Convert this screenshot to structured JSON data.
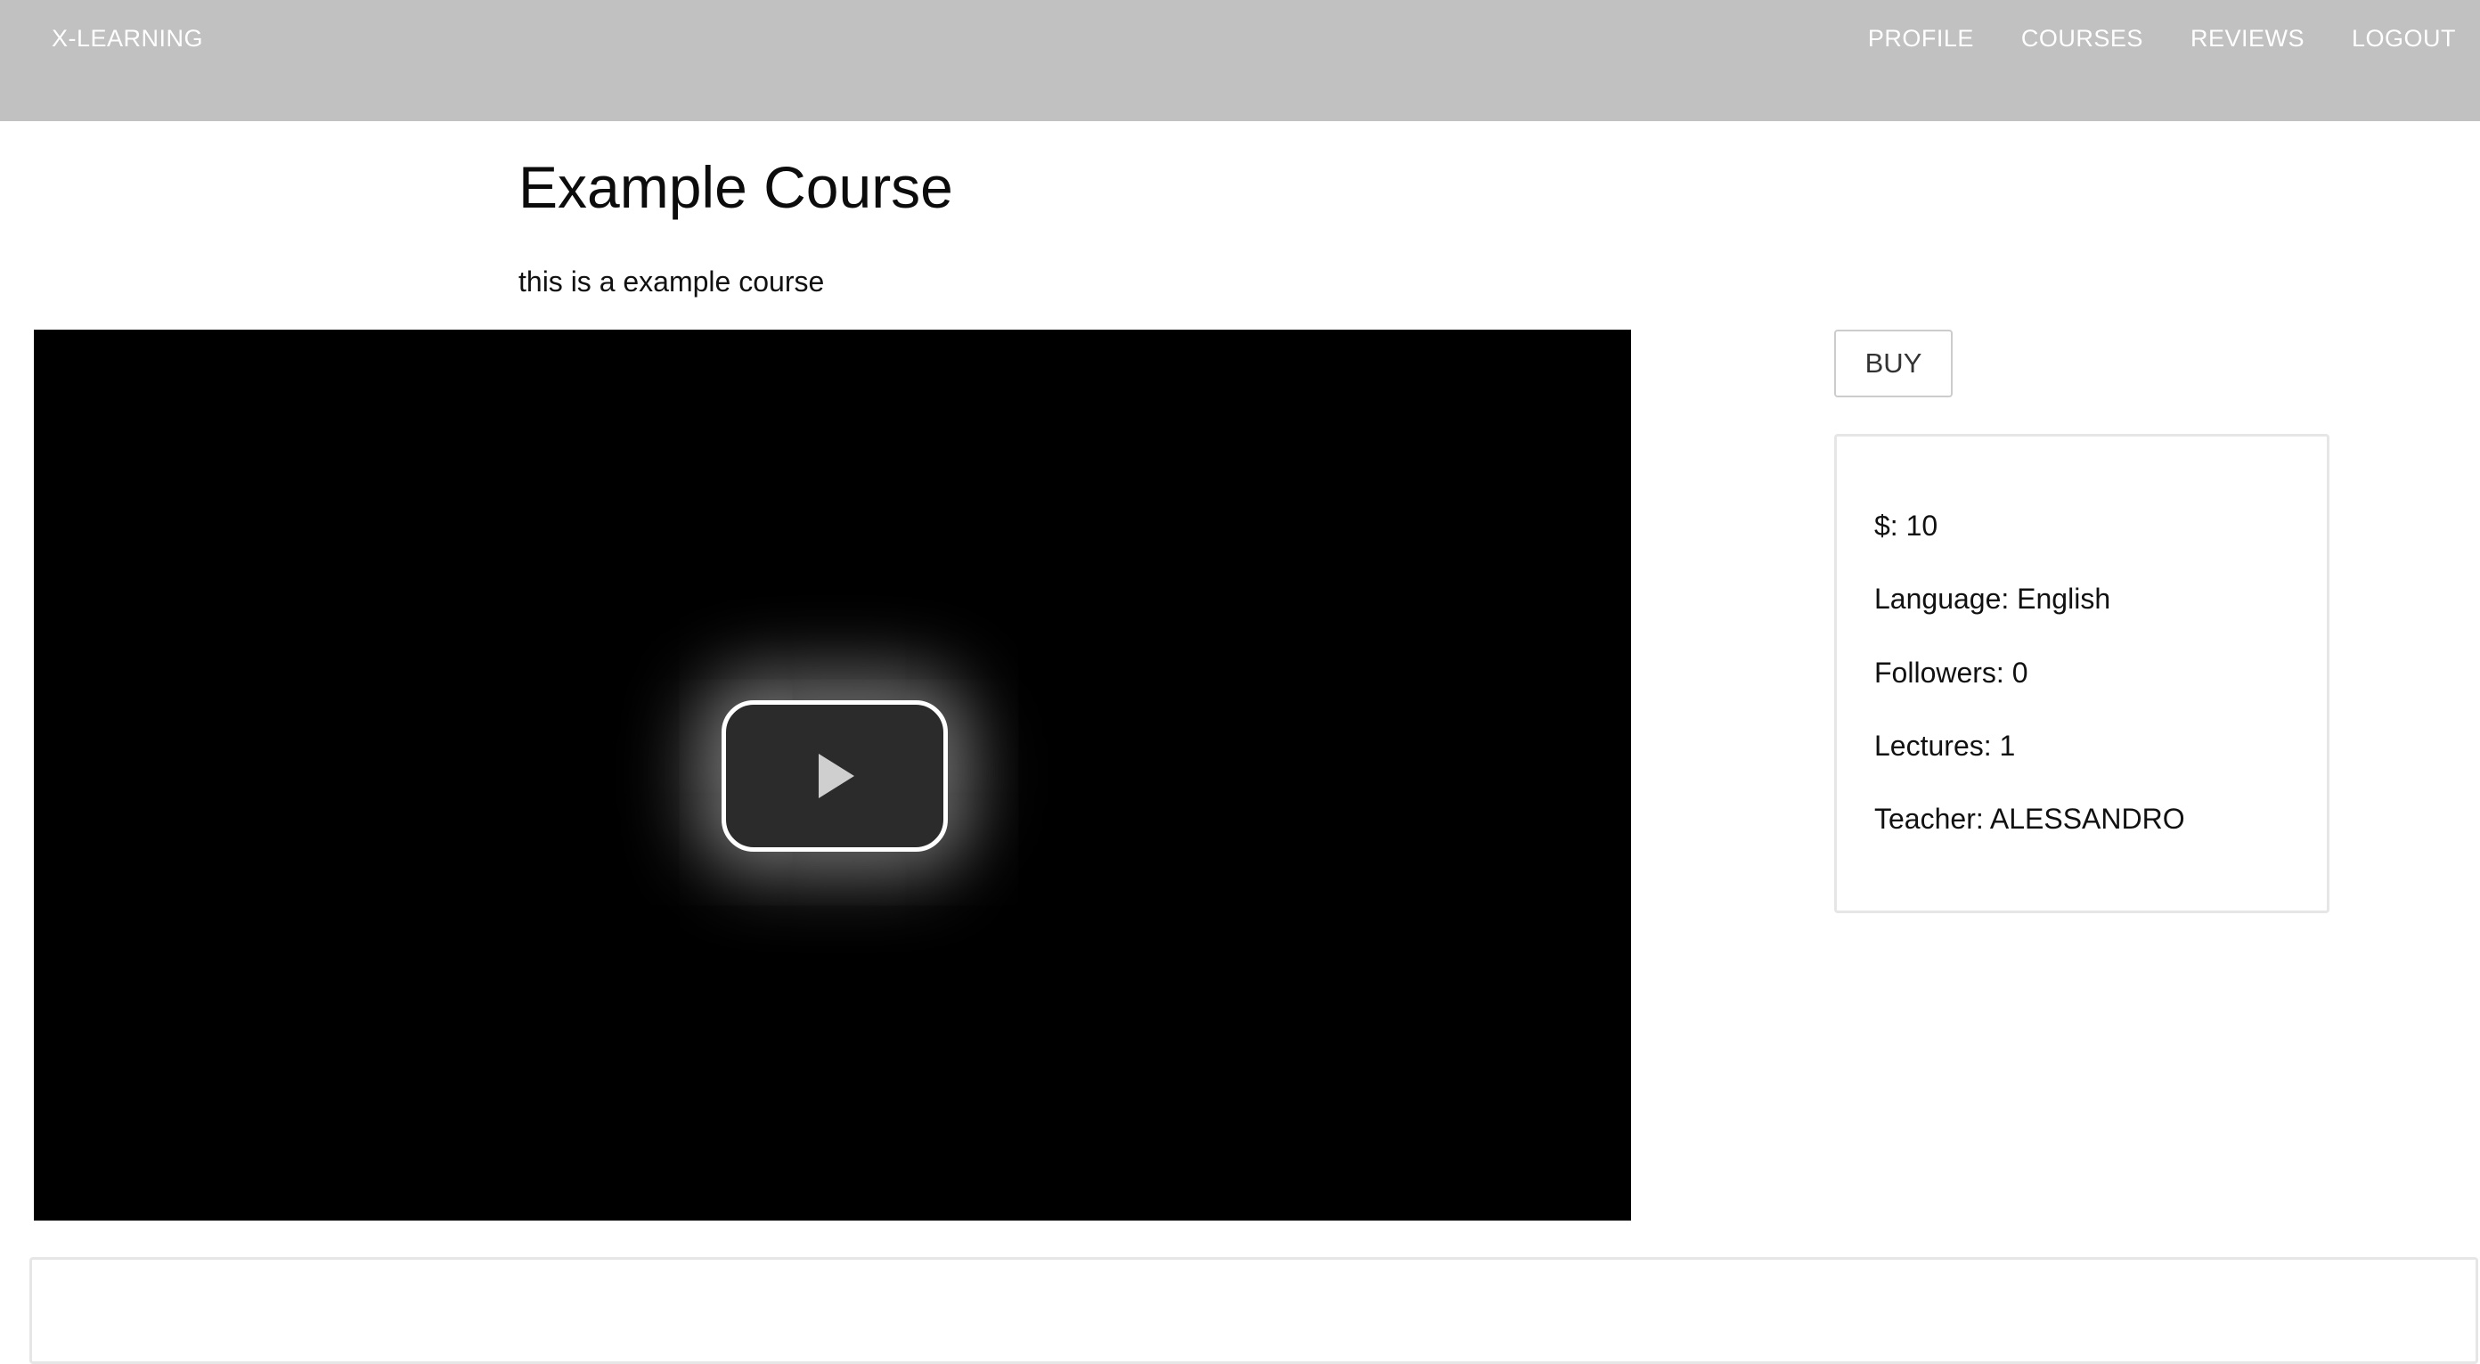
{
  "navbar": {
    "brand": "X-LEARNING",
    "links": [
      {
        "label": "PROFILE"
      },
      {
        "label": "COURSES"
      },
      {
        "label": "REVIEWS"
      },
      {
        "label": "LOGOUT"
      }
    ]
  },
  "course": {
    "title": "Example Course",
    "description": "this is a example course"
  },
  "video": {
    "play_icon": "play-icon"
  },
  "actions": {
    "buy_label": "BUY"
  },
  "info": {
    "price": "$: 10",
    "language": "Language: English",
    "followers": "Followers: 0",
    "lectures": "Lectures: 1",
    "teacher": "Teacher: ALESSANDRO"
  },
  "colors": {
    "navbar_bg": "#c1c1c1",
    "nav_text": "#ffffff",
    "video_bg": "#000000",
    "panel_border": "#e6e6e6"
  }
}
